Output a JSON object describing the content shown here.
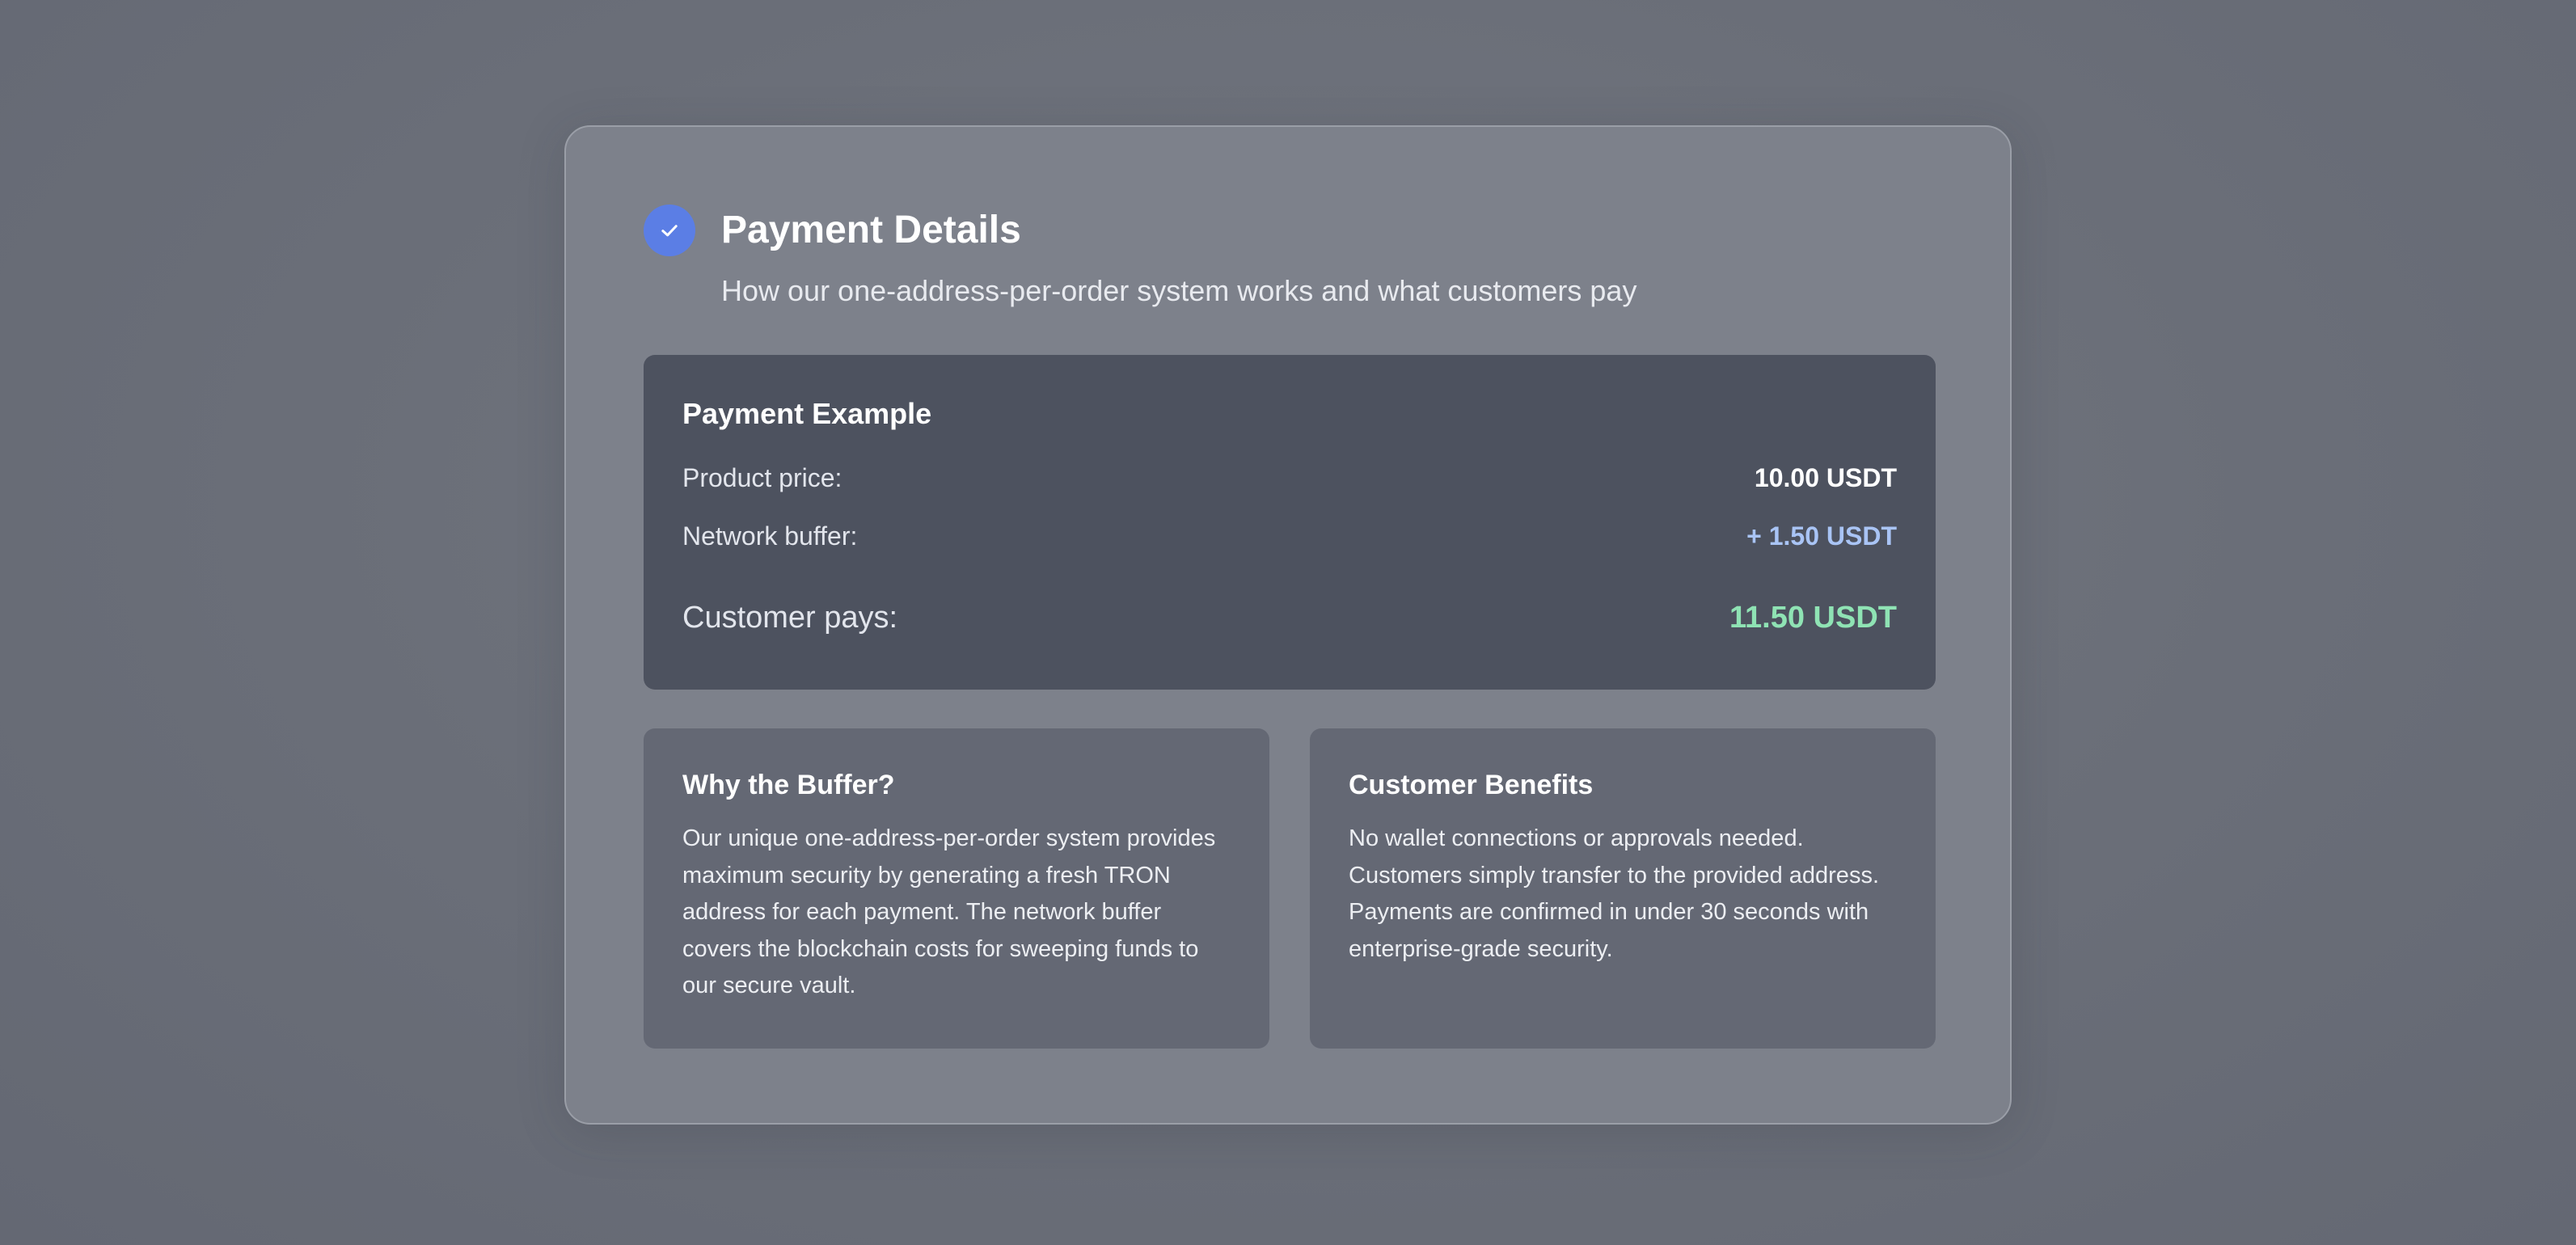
{
  "header": {
    "title": "Payment Details",
    "subtitle": "How our one-address-per-order system works and what customers pay",
    "icon": "check-icon"
  },
  "example": {
    "title": "Payment Example",
    "rows": [
      {
        "label": "Product price:",
        "value": "10.00 USDT",
        "color": "#ffffff"
      },
      {
        "label": "Network buffer:",
        "value": "+ 1.50 USDT",
        "color": "#a9c4f5"
      },
      {
        "label": "Customer pays:",
        "value": "11.50 USDT",
        "color": "#8fe3b4"
      }
    ]
  },
  "info": {
    "why_buffer": {
      "title": "Why the Buffer?",
      "body": "Our unique one-address-per-order system provides maximum security by generating a fresh TRON address for each payment. The network buffer covers the blockchain costs for sweeping funds to our secure vault."
    },
    "benefits": {
      "title": "Customer Benefits",
      "body": "No wallet connections or approvals needed. Customers simply transfer to the provided address. Payments are confirmed in under 30 seconds with enterprise-grade security."
    }
  },
  "colors": {
    "accent": "#5b7ee5",
    "buffer": "#a9c4f5",
    "total": "#8fe3b4"
  }
}
